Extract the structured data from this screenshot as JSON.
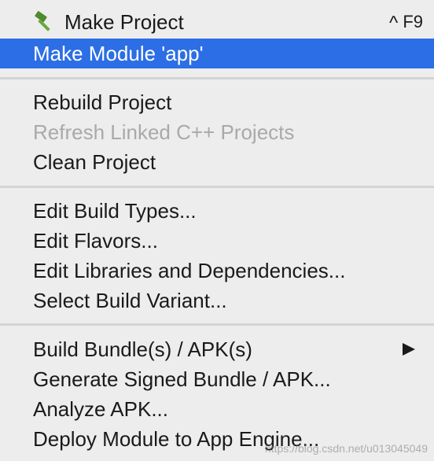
{
  "menu": {
    "make_project": {
      "label": "Make Project",
      "shortcut": "F9",
      "shortcut_modifier": "^",
      "icon": "hammer-icon"
    },
    "make_module": {
      "label": "Make Module 'app'"
    },
    "rebuild_project": {
      "label": "Rebuild Project"
    },
    "refresh_linked": {
      "label": "Refresh Linked C++ Projects"
    },
    "clean_project": {
      "label": "Clean Project"
    },
    "edit_build_types": {
      "label": "Edit Build Types..."
    },
    "edit_flavors": {
      "label": "Edit Flavors..."
    },
    "edit_libraries": {
      "label": "Edit Libraries and Dependencies..."
    },
    "select_build_variant": {
      "label": "Select Build Variant..."
    },
    "build_bundle": {
      "label": "Build Bundle(s) / APK(s)",
      "submenu_icon": "triangle-right-icon"
    },
    "generate_signed": {
      "label": "Generate Signed Bundle / APK..."
    },
    "analyze_apk": {
      "label": "Analyze APK..."
    },
    "deploy_module": {
      "label": "Deploy Module to App Engine..."
    }
  },
  "watermark": "https://blog.csdn.net/u013045049",
  "colors": {
    "selection": "#2c6ee5",
    "background": "#ededed",
    "disabled_text": "#a9a9a9",
    "separator": "#d4d4d4"
  }
}
